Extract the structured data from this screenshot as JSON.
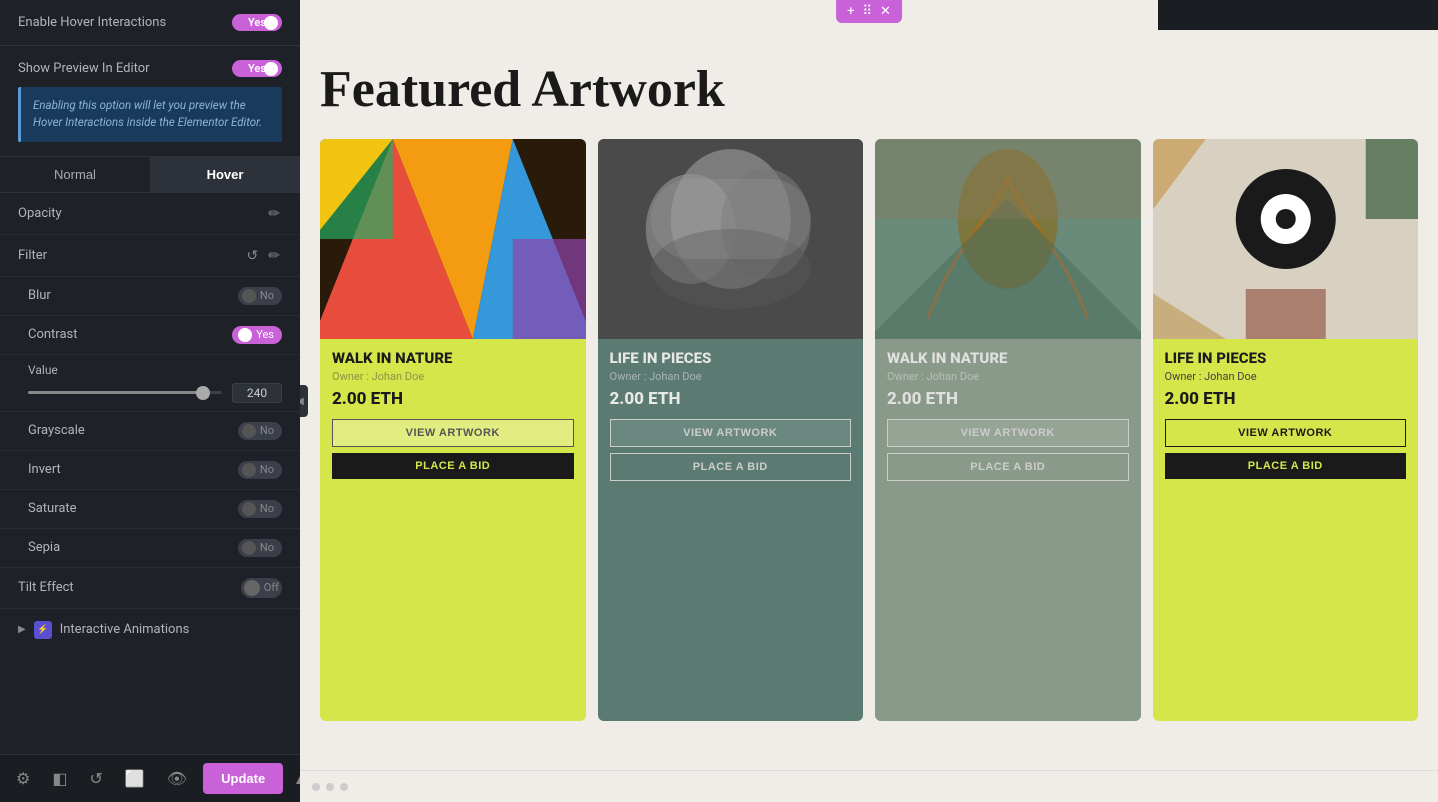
{
  "panel": {
    "hover_interactions_label": "Enable Hover Interactions",
    "hover_interactions_value": "Yes",
    "show_preview_label": "Show Preview In Editor",
    "show_preview_value": "Yes",
    "info_text": "Enabling this option will let you preview the Hover Interactions inside the Elementor Editor.",
    "tabs": [
      {
        "label": "Normal",
        "active": false
      },
      {
        "label": "Hover",
        "active": true
      }
    ],
    "opacity_label": "Opacity",
    "filter_label": "Filter",
    "blur_label": "Blur",
    "blur_value": "No",
    "contrast_label": "Contrast",
    "contrast_value": "Yes",
    "value_label": "Value",
    "slider_value": "240",
    "grayscale_label": "Grayscale",
    "grayscale_value": "No",
    "invert_label": "Invert",
    "invert_value": "No",
    "saturate_label": "Saturate",
    "saturate_value": "No",
    "sepia_label": "Sepia",
    "sepia_value": "No",
    "tilt_label": "Tilt Effect",
    "tilt_value": "Off",
    "interactive_animations_label": "Interactive Animations",
    "update_label": "Update"
  },
  "main": {
    "featured_title": "Featured Artwork",
    "cards": [
      {
        "title": "WALK IN NATURE",
        "owner": "Owner : Johan Doe",
        "price": "2.00 ETH",
        "view_label": "VIEW ARTWORK",
        "bid_label": "PLACE A BID",
        "art_style": "art-1",
        "card_class": "card-1"
      },
      {
        "title": "LIFE IN PIECES",
        "owner": "Owner : Johan Doe",
        "price": "2.00 ETH",
        "view_label": "VIEW ARTWORK",
        "bid_label": "PLACE A BID",
        "art_style": "art-2",
        "card_class": "card-2"
      },
      {
        "title": "WALK IN NATURE",
        "owner": "Owner : Johan Doe",
        "price": "2.00 ETH",
        "view_label": "VIEW ARTWORK",
        "bid_label": "PLACE A BID",
        "art_style": "art-3",
        "card_class": "card-3"
      },
      {
        "title": "LIFE IN PIECES",
        "owner": "Owner : Johan Doe",
        "price": "2.00 ETH",
        "view_label": "VIEW ARTWORK",
        "bid_label": "PLACE A BID",
        "art_style": "art-4",
        "card_class": "card-4"
      }
    ]
  },
  "toolbar": {
    "settings_icon": "⚙",
    "layers_icon": "◧",
    "history_icon": "↺",
    "responsive_icon": "⬜",
    "preview_icon": "👁"
  }
}
